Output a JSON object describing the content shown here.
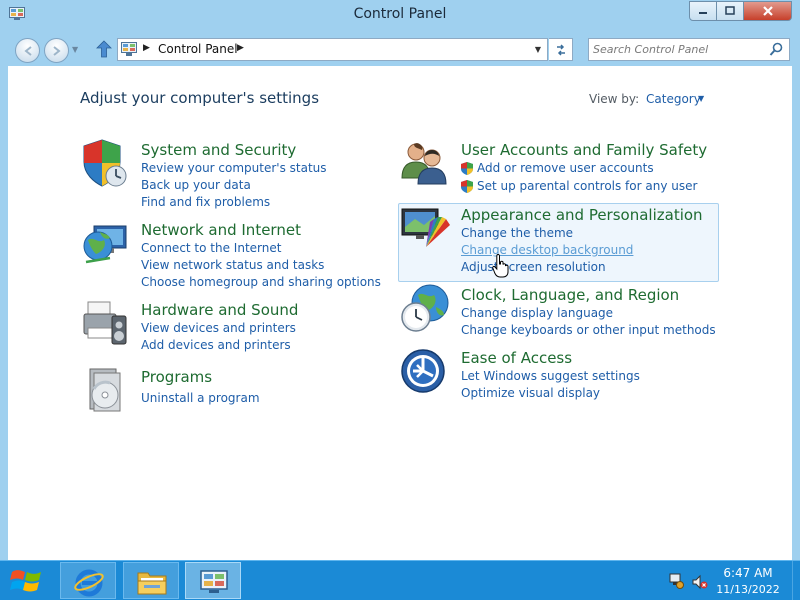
{
  "window": {
    "title": "Control Panel"
  },
  "address_bar": {
    "crumb": "Control Panel",
    "search_placeholder": "Search Control Panel"
  },
  "content": {
    "heading": "Adjust your computer's settings",
    "view_by_label": "View by:",
    "view_by_value": "Category"
  },
  "categories": {
    "system_security": {
      "title": "System and Security",
      "links": [
        "Review your computer's status",
        "Back up your data",
        "Find and fix problems"
      ]
    },
    "network_internet": {
      "title": "Network and Internet",
      "links": [
        "Connect to the Internet",
        "View network status and tasks",
        "Choose homegroup and sharing options"
      ]
    },
    "hardware_sound": {
      "title": "Hardware and Sound",
      "links": [
        "View devices and printers",
        "Add devices and printers"
      ]
    },
    "programs": {
      "title": "Programs",
      "links": [
        "Uninstall a program"
      ]
    },
    "user_accounts": {
      "title": "User Accounts and Family Safety",
      "links": [
        "Add or remove user accounts",
        "Set up parental controls for any user"
      ]
    },
    "appearance": {
      "title": "Appearance and Personalization",
      "links": [
        "Change the theme",
        "Change desktop background",
        "Adjust screen resolution"
      ]
    },
    "clock_region": {
      "title": "Clock, Language, and Region",
      "links": [
        "Change display language",
        "Change keyboards or other input methods"
      ]
    },
    "ease_access": {
      "title": "Ease of Access",
      "links": [
        "Let Windows suggest settings",
        "Optimize visual display"
      ]
    }
  },
  "taskbar": {
    "time": "6:47 AM",
    "date": "11/13/2022"
  },
  "colors": {
    "category_title": "#1e6b31",
    "link": "#1e5da8",
    "taskbar": "#1b8ad6",
    "frame": "#9fd0ef"
  }
}
